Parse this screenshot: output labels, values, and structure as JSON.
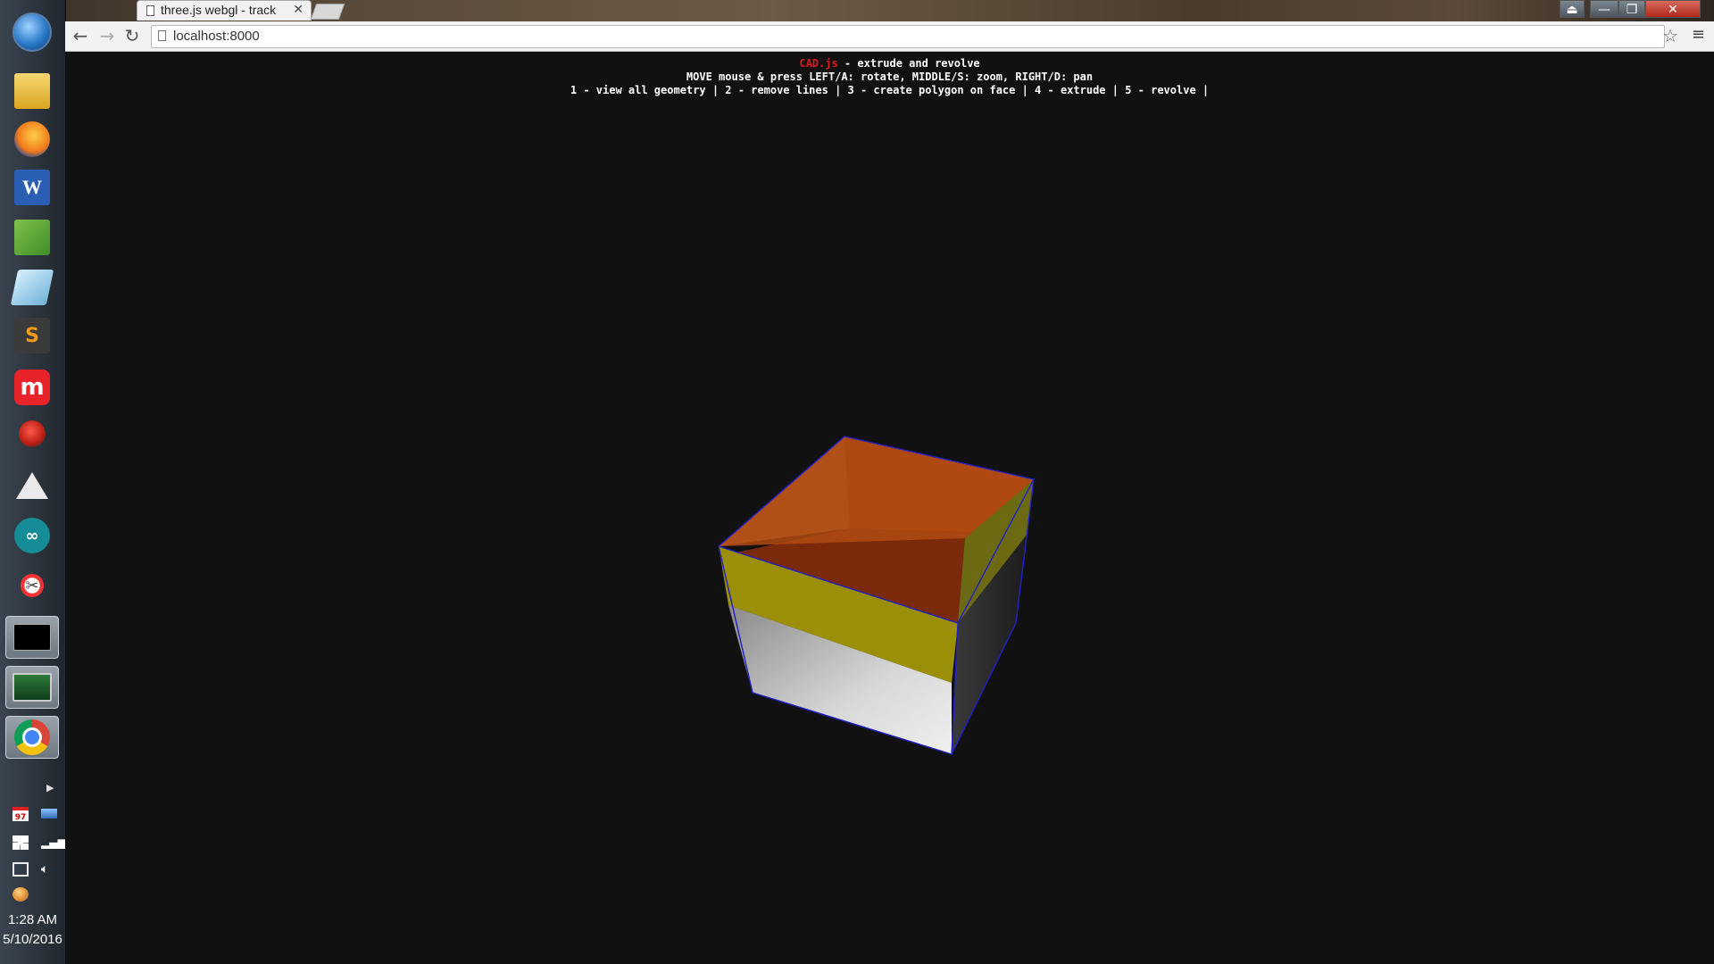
{
  "browser": {
    "tab_title": "three.js webgl - track",
    "close_tab": "✕",
    "url": "localhost:8000",
    "back": "←",
    "forward": "→",
    "reload": "↻",
    "star": "☆",
    "menu": "≡",
    "minimize": "—",
    "maximize": "❐",
    "close": "✕"
  },
  "info": {
    "brand": "CAD.js",
    "title_rest": " - extrude and revolve",
    "line2": "MOVE mouse & press LEFT/A: rotate, MIDDLE/S: zoom, RIGHT/D: pan",
    "line3": "1 - view all geometry | 2 - remove lines | 3 - create polygon on face | 4 - extrude | 5 - revolve |"
  },
  "taskbar": {
    "apps": [
      "file-explorer",
      "firefox",
      "word",
      "notepad-plus",
      "eraser-app",
      "sublime-text",
      "makerbot",
      "ladybug",
      "inkscape",
      "arduino",
      "snipping-tool",
      "command-prompt",
      "network-monitor",
      "chrome"
    ],
    "active_app": "chrome",
    "time": "1:28 AM",
    "date": "5/10/2016",
    "calendar_badge": "97"
  },
  "colors": {
    "box_top": "#b04a10",
    "box_yellow": "#a0900a",
    "box_white": "#d6d6d6",
    "edge": "#1a1ad0"
  }
}
